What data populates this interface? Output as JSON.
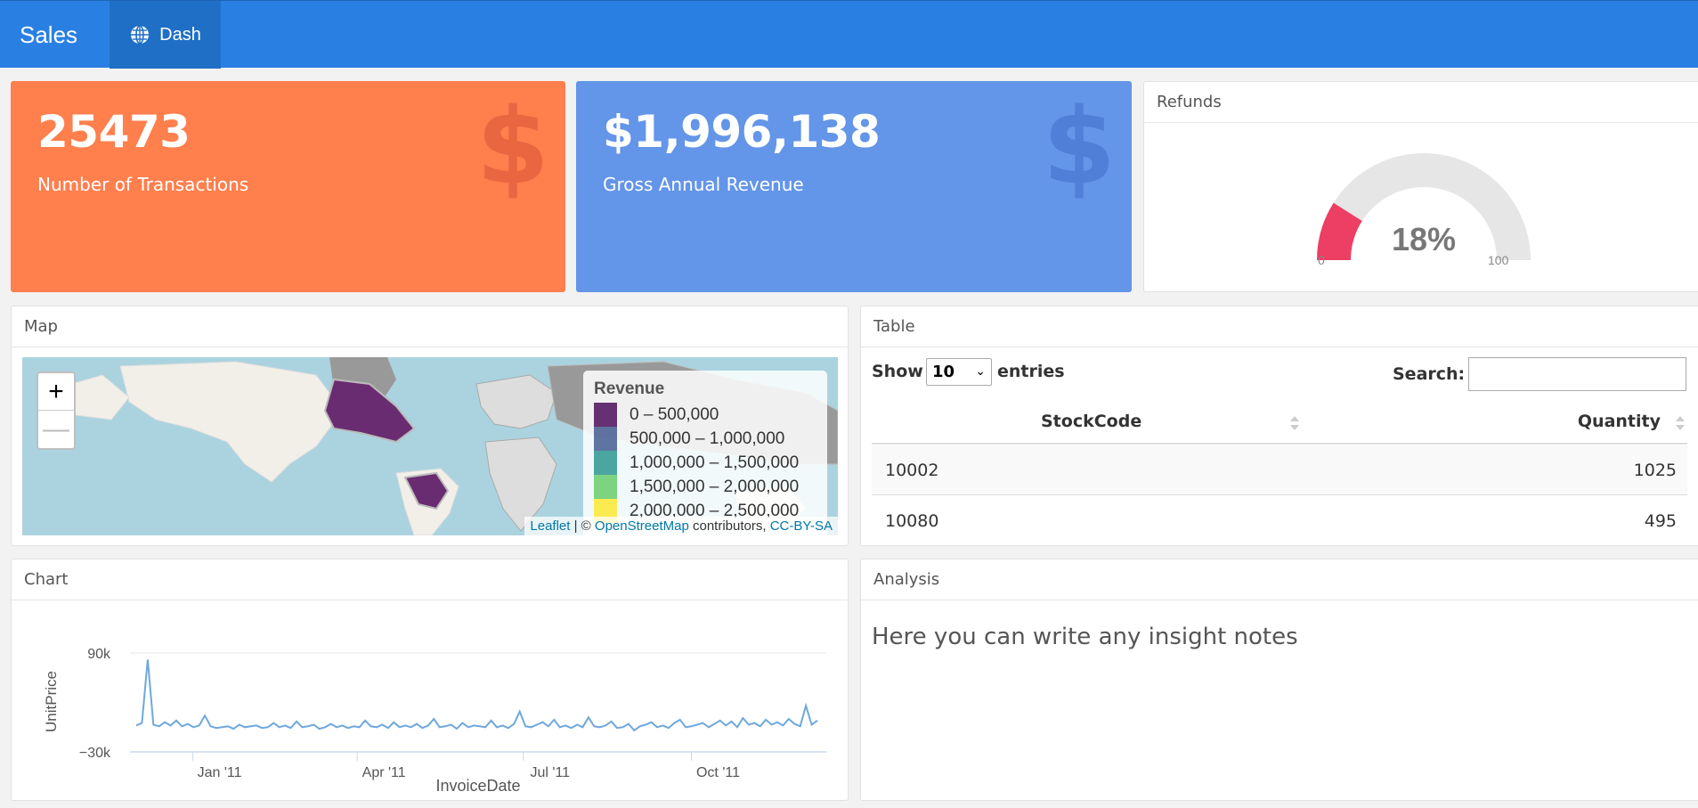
{
  "header": {
    "brand": "Sales",
    "tabs": [
      {
        "label": "Dash",
        "icon": "globe-icon"
      }
    ]
  },
  "value_boxes": [
    {
      "value": "25473",
      "subtitle": "Number of Transactions",
      "icon": "dollar-icon",
      "color": "#ff7f4d"
    },
    {
      "value": "$1,996,138",
      "subtitle": "Gross Annual Revenue",
      "icon": "dollar-icon",
      "color": "#6395e8"
    }
  ],
  "refunds": {
    "title": "Refunds",
    "percent_label": "18%",
    "value": 18,
    "min": "0",
    "max": "100",
    "fill_color": "#ec3f63",
    "track_color": "#e6e6e6"
  },
  "map": {
    "title": "Map",
    "zoom_in": "+",
    "zoom_out": "—",
    "legend_title": "Revenue",
    "legend": [
      {
        "label": "0 – 500,000",
        "color": "#440154"
      },
      {
        "label": "500,000 – 1,000,000",
        "color": "#3b528b"
      },
      {
        "label": "1,000,000 – 1,500,000",
        "color": "#21918c"
      },
      {
        "label": "1,500,000 – 2,000,000",
        "color": "#5ec962"
      },
      {
        "label": "2,000,000 – 2,500,000",
        "color": "#fde725"
      }
    ],
    "attribution": {
      "leaflet": "Leaflet",
      "sep": " | © ",
      "osm": "OpenStreetMap",
      "contrib": " contributors, ",
      "license": "CC-BY-SA"
    }
  },
  "table": {
    "title": "Table",
    "show_label": "Show",
    "page_size": "10",
    "entries_label": "entries",
    "search_label": "Search:",
    "search_value": "",
    "columns": [
      "StockCode",
      "Quantity"
    ],
    "rows": [
      [
        "10002",
        "1025"
      ],
      [
        "10080",
        "495"
      ]
    ]
  },
  "chart": {
    "title": "Chart"
  },
  "chart_data": {
    "type": "line",
    "xlabel": "InvoiceDate",
    "ylabel": "UnitPrice",
    "ylim": [
      -30000,
      90000
    ],
    "y_ticks": [
      "90k",
      "−30k"
    ],
    "x_ticks": [
      "Jan '11",
      "Apr '11",
      "Jul '11",
      "Oct '11"
    ],
    "series": [
      {
        "color": "#6fa8dc",
        "x_start": "2010-12-01",
        "x_end": "2011-12-09",
        "values": [
          2000,
          5000,
          82000,
          3000,
          1000,
          6000,
          2000,
          8000,
          1000,
          4000,
          0,
          2000,
          14000,
          1000,
          -1000,
          0,
          1000,
          -2000,
          3000,
          0,
          1000,
          2000,
          -1000,
          0,
          5000,
          0,
          2000,
          -1000,
          7000,
          0,
          1000,
          3000,
          -2000,
          0,
          4000,
          0,
          2000,
          -1000,
          1000,
          0,
          8000,
          1000,
          0,
          3000,
          -1000,
          6000,
          0,
          2000,
          0,
          4000,
          -1000,
          2000,
          10000,
          0,
          1000,
          3000,
          -2000,
          5000,
          0,
          2000,
          1000,
          0,
          8000,
          0,
          2000,
          -1000,
          4000,
          19000,
          1000,
          0,
          3000,
          6000,
          1000,
          9000,
          0,
          2000,
          -1000,
          3000,
          0,
          12000,
          1000,
          0,
          2000,
          7000,
          -1000,
          0,
          4000,
          -4000,
          1000,
          3000,
          6000,
          0,
          2000,
          -1000,
          5000,
          9000,
          0,
          1000,
          3000,
          5000,
          0,
          4000,
          8000,
          2000,
          7000,
          0,
          11000,
          3000,
          5000,
          1000,
          9000,
          3000,
          6000,
          2000,
          10000,
          4000,
          1000,
          26000,
          3000,
          8000
        ]
      }
    ]
  },
  "analysis": {
    "title": "Analysis",
    "note": "Here you can write any insight notes"
  }
}
